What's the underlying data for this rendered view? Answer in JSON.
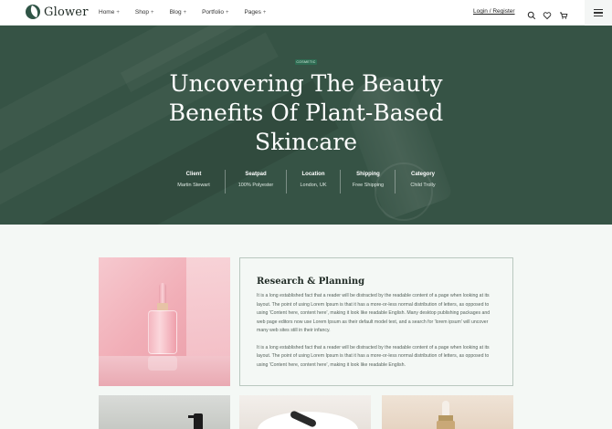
{
  "brand": {
    "name": "Glower",
    "accent": "#2f5446"
  },
  "nav": {
    "items": [
      {
        "label": "Home",
        "suffix": "+"
      },
      {
        "label": "Shop",
        "suffix": "+"
      },
      {
        "label": "Blog",
        "suffix": "+"
      },
      {
        "label": "Portfolio",
        "suffix": "+"
      },
      {
        "label": "Pages",
        "suffix": "+"
      }
    ],
    "login_label": "Login / Register",
    "icons": [
      "search-icon",
      "heart-icon",
      "cart-icon",
      "hamburger-menu-icon"
    ]
  },
  "hero": {
    "badge": "COSMETIC",
    "title": "Uncovering The Beauty Benefits Of Plant-Based Skincare",
    "meta": [
      {
        "key": "Client",
        "value": "Martin Stewart"
      },
      {
        "key": "Seatpad",
        "value": "100% Polyester"
      },
      {
        "key": "Location",
        "value": "London, UK"
      },
      {
        "key": "Shipping",
        "value": "Free Shipping"
      },
      {
        "key": "Category",
        "value": "Child Trolly"
      }
    ]
  },
  "content": {
    "card_title": "Research & Planning",
    "paragraphs": [
      "It is a long established fact that a reader will be distracted by the readable content of a page when looking at its layout. The point of using Lorem Ipsum is that it has a more-or-less normal distribution of letters, as opposed to using 'Content here, content here', making it look like readable English. Many desktop publishing packages and web page editors now use Lorem Ipsum as their default model text, and a search for 'lorem ipsum' will uncover many web sites still in their infancy.",
      "It is a long established fact that a reader will be distracted by the readable content of a page when looking at its layout. The point of using Lorem Ipsum is that it has a more-or-less normal distribution of letters, as opposed to using 'Content here, content here', making it look like readable English."
    ]
  }
}
